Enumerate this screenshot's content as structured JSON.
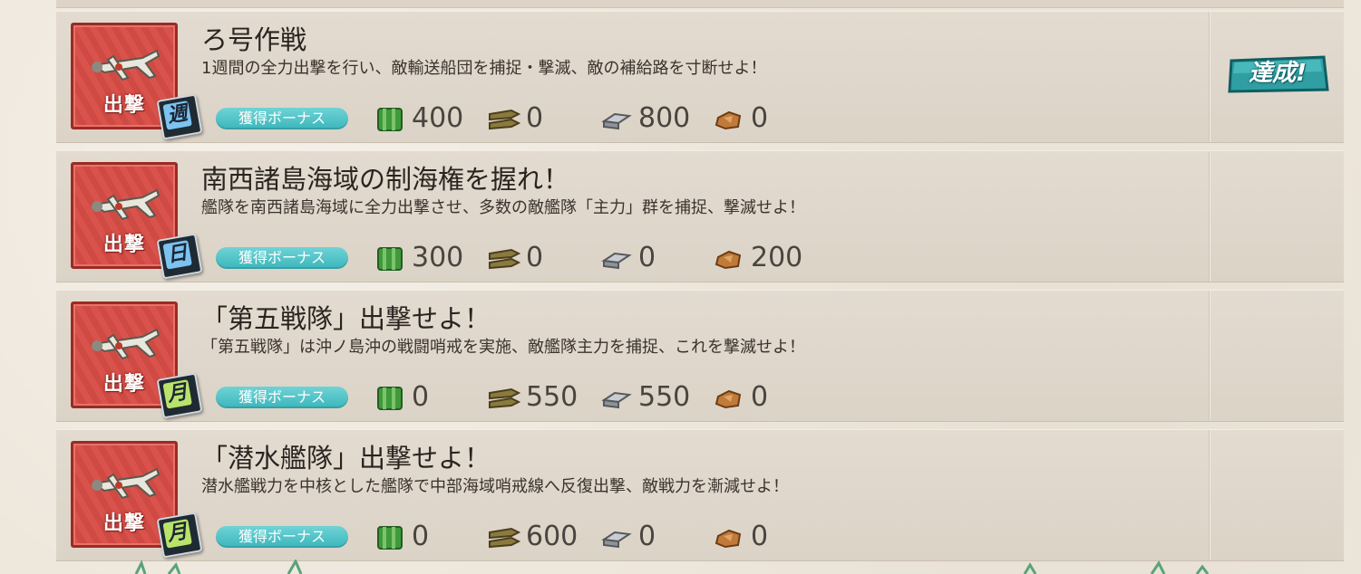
{
  "quests": [
    {
      "category": "出撃",
      "frequency": "週",
      "frequency_color": "#7cc3f2",
      "title": "ろ号作戦",
      "description": "1週間の全力出撃を行い、敵輸送船団を捕捉・撃滅、敵の補給路を寸断せよ！",
      "bonus_label": "獲得ボーナス",
      "fuel": "400",
      "ammo": "0",
      "steel": "800",
      "bauxite": "0",
      "status": "達成!"
    },
    {
      "category": "出撃",
      "frequency": "日",
      "frequency_color": "#7cc3f2",
      "title": "南西諸島海域の制海権を握れ！",
      "description": "艦隊を南西諸島海域に全力出撃させ、多数の敵艦隊「主力」群を捕捉、撃滅せよ！",
      "bonus_label": "獲得ボーナス",
      "fuel": "300",
      "ammo": "0",
      "steel": "0",
      "bauxite": "200",
      "status": ""
    },
    {
      "category": "出撃",
      "frequency": "月",
      "frequency_color": "#b9e36b",
      "title": "「第五戦隊」出撃せよ！",
      "description": "「第五戦隊」は沖ノ島沖の戦闘哨戒を実施、敵艦隊主力を捕捉、これを撃滅せよ！",
      "bonus_label": "獲得ボーナス",
      "fuel": "0",
      "ammo": "550",
      "steel": "550",
      "bauxite": "0",
      "status": ""
    },
    {
      "category": "出撃",
      "frequency": "月",
      "frequency_color": "#b9e36b",
      "title": "「潜水艦隊」出撃せよ！",
      "description": "潜水艦戦力を中核とした艦隊で中部海域哨戒線へ反復出撃、敵戦力を漸減せよ！",
      "bonus_label": "獲得ボーナス",
      "fuel": "0",
      "ammo": "600",
      "steel": "0",
      "bauxite": "0",
      "status": ""
    }
  ],
  "icons": {
    "category": "plane-icon",
    "fuel": "fuel-icon",
    "ammo": "ammo-icon",
    "steel": "steel-icon",
    "bauxite": "bauxite-icon",
    "complete": "complete-badge-icon"
  },
  "colors": {
    "sortie_red": "#d9534c",
    "bonus_teal": "#3bb6bb",
    "weekly_daily_blue": "#7cc3f2",
    "monthly_green": "#b9e36b"
  }
}
